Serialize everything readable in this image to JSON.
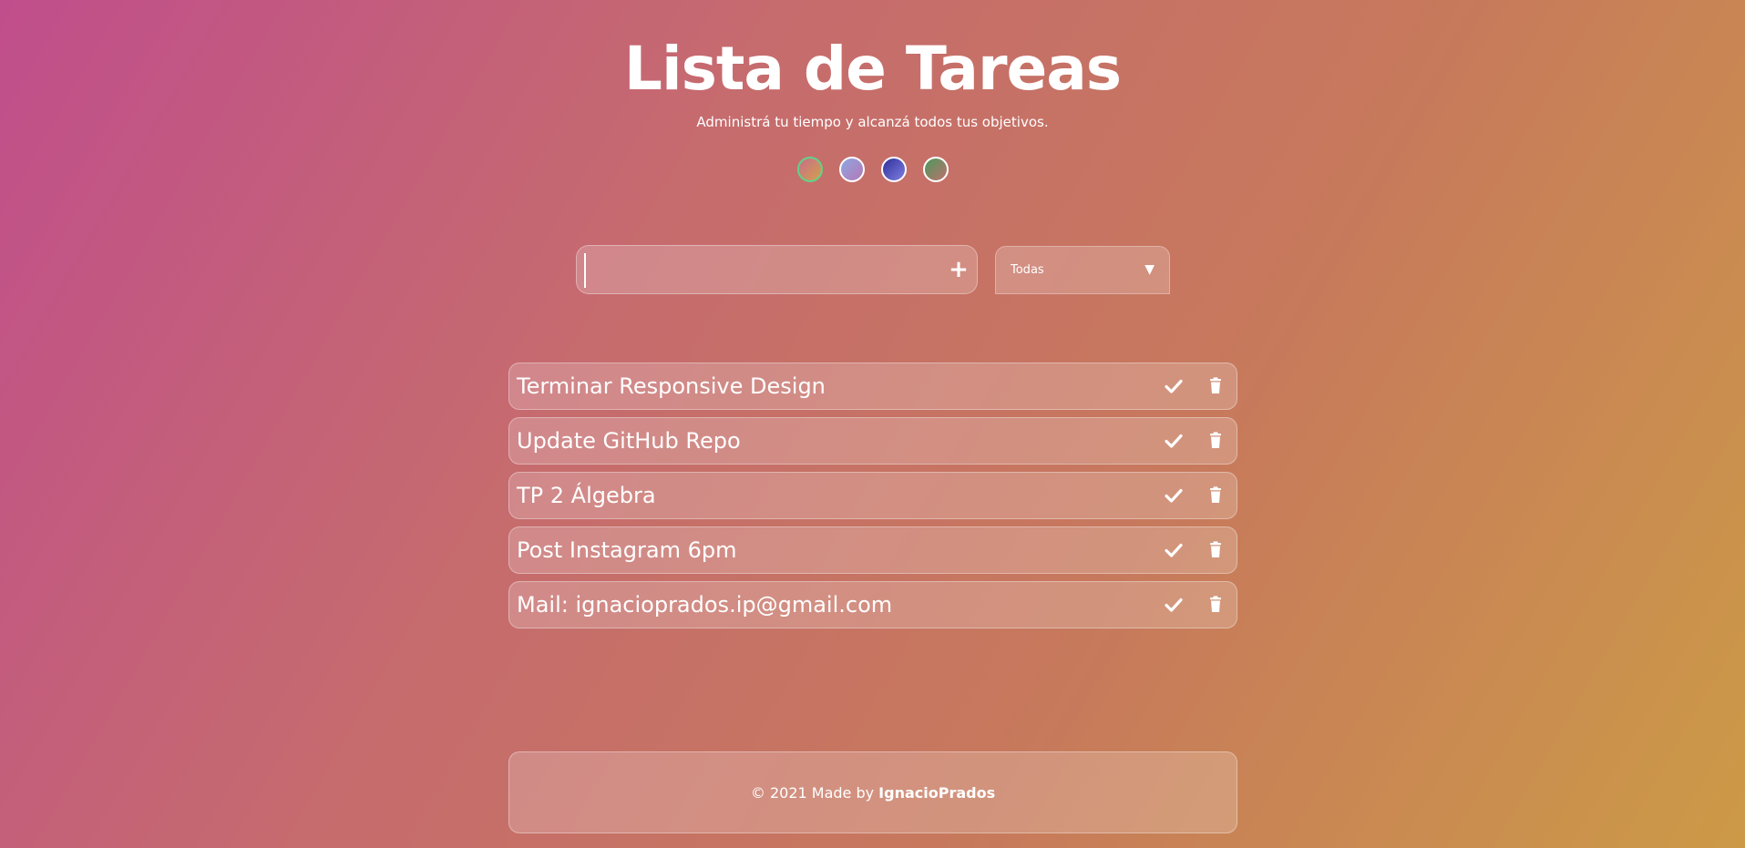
{
  "header": {
    "title": "Lista de Tareas",
    "subtitle": "Administrá tu tiempo y alcanzá todos tus objetivos."
  },
  "themes": [
    {
      "name": "sunset",
      "gradient": [
        "#c86d8a",
        "#d3a04c"
      ],
      "selected": true
    },
    {
      "name": "lavender",
      "gradient": [
        "#8ea6e0",
        "#b478b8"
      ],
      "selected": false
    },
    {
      "name": "indigo",
      "gradient": [
        "#2f2f9c",
        "#7f7fe0"
      ],
      "selected": false
    },
    {
      "name": "forest",
      "gradient": [
        "#4a9a5c",
        "#c0706e"
      ],
      "selected": false
    }
  ],
  "input": {
    "value": "",
    "placeholder": "",
    "add_icon": "plus-icon"
  },
  "filter": {
    "selected": "Todas",
    "arrow": "▼"
  },
  "todos": [
    {
      "text": "Terminar Responsive Design"
    },
    {
      "text": "Update GitHub Repo"
    },
    {
      "text": "TP 2 Álgebra"
    },
    {
      "text": "Post Instagram 6pm"
    },
    {
      "text": "Mail: ignacioprados.ip@gmail.com"
    }
  ],
  "footer": {
    "prefix": "© 2021 Made by ",
    "author": "IgnacioPrados"
  },
  "colors": {
    "bg_start": "#c04e8c",
    "bg_end": "#cc9a47",
    "selected_theme_border": "#5fd38a"
  }
}
